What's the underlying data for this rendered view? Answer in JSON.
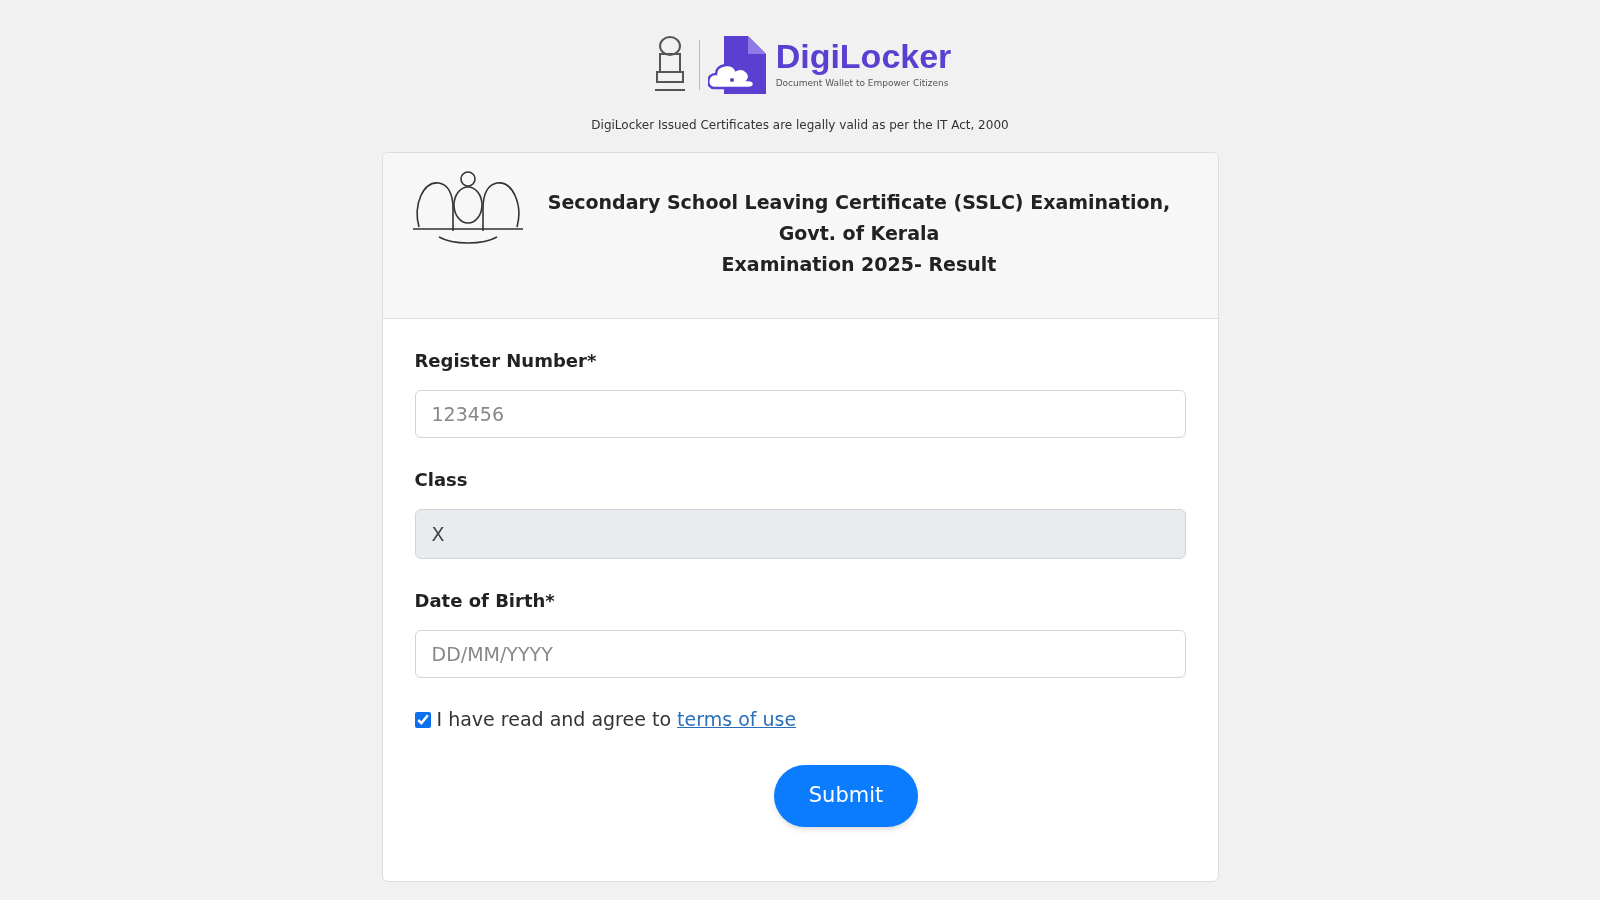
{
  "logo": {
    "name": "DigiLocker",
    "tagline": "Document Wallet to Empower Citizens"
  },
  "notice": "DigiLocker Issued Certificates are legally valid as per the IT Act, 2000",
  "card": {
    "title_lines": [
      "Secondary School Leaving Certificate (SSLC) Examination, Govt. of Kerala",
      "Examination 2025- Result"
    ]
  },
  "fields": [
    {
      "label": "Register Number*",
      "placeholder": "123456",
      "disabled": false
    },
    {
      "label": "Class",
      "value": "X",
      "disabled": true
    },
    {
      "label": "Date of Birth*",
      "placeholder": "DD/MM/YYYY",
      "disabled": false
    }
  ],
  "agreement": {
    "text": "I have read and agree to",
    "link": "terms of use",
    "checked": true
  },
  "submit": "Submit"
}
